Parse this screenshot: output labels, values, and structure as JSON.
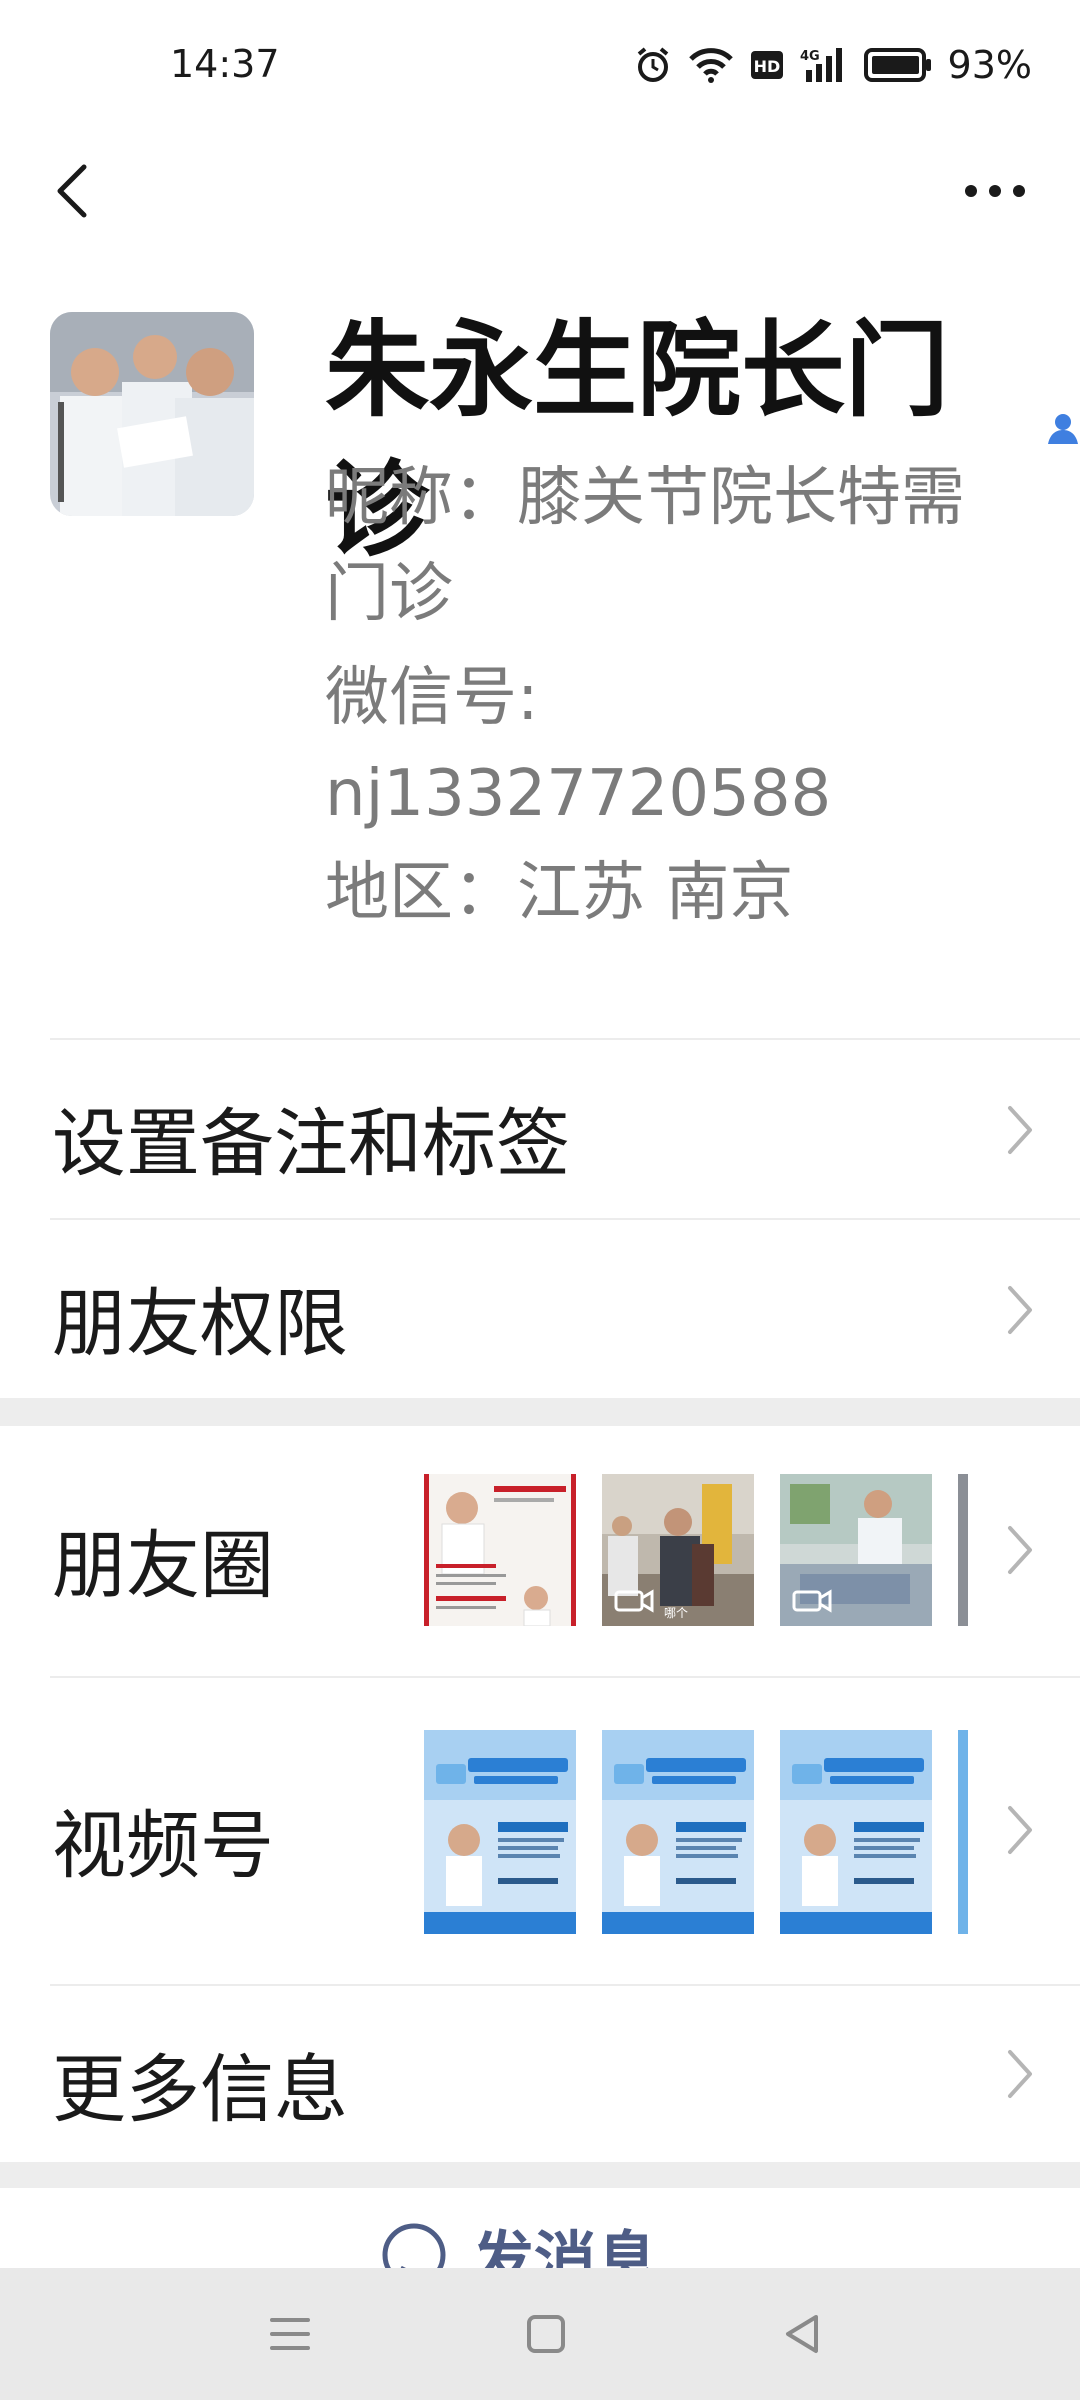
{
  "status_bar": {
    "time": "14:37",
    "battery": "93%",
    "icons": [
      "alarm-icon",
      "wifi-icon",
      "hd-icon",
      "4g-signal-icon",
      "battery-icon"
    ]
  },
  "nav": {
    "back_icon": "chevron-left-icon",
    "more_icon": "more-dots-icon"
  },
  "profile": {
    "name": "朱永生院长门诊",
    "nickname_line1": "昵称：膝关节院长特需",
    "nickname_line2": "门诊",
    "wechat_line1": "微信号:",
    "wechat_line2": "nj13327720588",
    "region": "地区：江苏  南京"
  },
  "rows": {
    "remark_tags": "设置备注和标签",
    "friend_permissions": "朋友权限",
    "moments": "朋友圈",
    "channels": "视频号",
    "more_info": "更多信息"
  },
  "moments_thumbs": [
    {
      "kind": "poster",
      "caption": ""
    },
    {
      "kind": "video",
      "caption": "哪个"
    },
    {
      "kind": "video",
      "caption": ""
    }
  ],
  "channel_thumbs": [
    {
      "headline": "农忙时如何保护膝盖",
      "doctor": "朱永生 院长"
    },
    {
      "headline": "40岁后膝关节会发生什么呢？",
      "doctor": "朱永生 院长"
    },
    {
      "headline": "半月板损伤了就是不能跑步了？",
      "doctor": "朱永生 院长"
    }
  ],
  "send_message": "发消息",
  "colors": {
    "accent_blue": "#3f7fe0",
    "link_blue": "#4e5d86",
    "band_gray": "#ededed",
    "text_gray": "#7b7b7b"
  }
}
